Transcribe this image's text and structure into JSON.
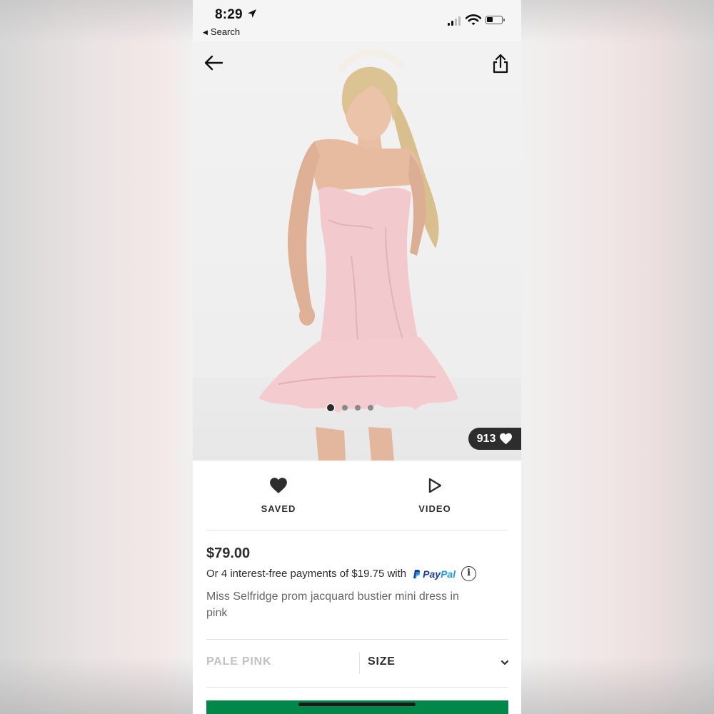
{
  "status_bar": {
    "time": "8:29",
    "back_app": "Search"
  },
  "product": {
    "likes": "913",
    "image_count": 4,
    "active_image_index": 0,
    "price": "$79.00",
    "installments_text": "Or 4 interest-free payments of $19.75 with",
    "paypal_pay": "Pay",
    "paypal_pal": "Pal",
    "info_glyph": "i",
    "title": "Miss Selfridge prom jacquard bustier mini dress in pink"
  },
  "actions": {
    "saved_label": "SAVED",
    "video_label": "VIDEO"
  },
  "selectors": {
    "color_value": "PALE PINK",
    "size_label": "SIZE"
  },
  "icons": {
    "back": "arrow-left-icon",
    "share": "share-icon",
    "saved": "heart-filled-icon",
    "video": "play-outline-icon",
    "likes": "heart-icon",
    "chevron": "chevron-down-icon",
    "info": "info-circle-icon"
  },
  "colors": {
    "text_dark": "#2d2d2d",
    "text_muted": "#666666",
    "color_placeholder": "#c2c2c2",
    "accent_green": "#018849",
    "paypal_dark": "#1a3f9a",
    "paypal_light": "#229ae2",
    "dress_pink": "#f2c9cd"
  }
}
